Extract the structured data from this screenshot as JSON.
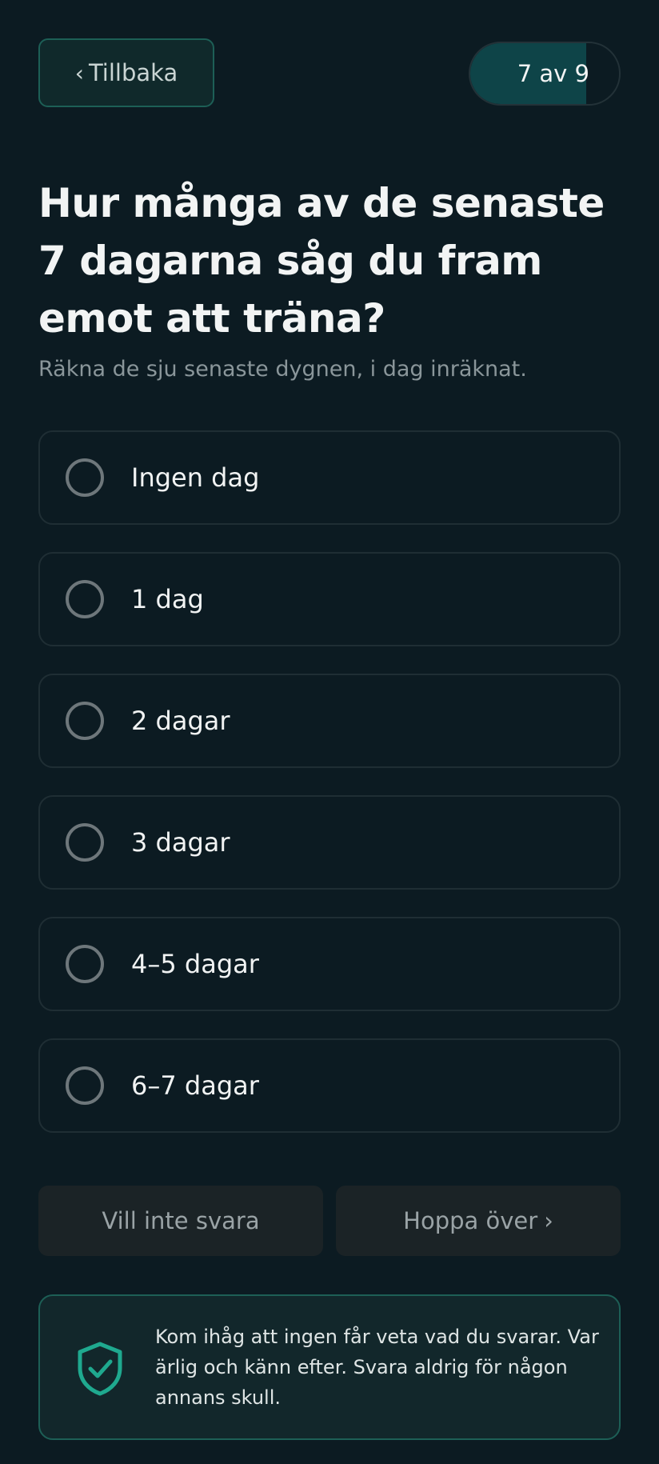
{
  "header": {
    "back_label": "Tillbaka",
    "back_chevron": "‹",
    "progress_label": "7 av 9",
    "progress_current": 7,
    "progress_total": 9
  },
  "question": {
    "title": "Hur många av de senaste 7 dagarna såg du fram emot att träna?",
    "hint": "Räkna de sju senaste dygnen, i dag inräknat."
  },
  "options": [
    {
      "label": "Ingen dag",
      "selected": false
    },
    {
      "label": "1 dag",
      "selected": false
    },
    {
      "label": "2 dagar",
      "selected": false
    },
    {
      "label": "3 dagar",
      "selected": false
    },
    {
      "label": "4–5 dagar",
      "selected": false
    },
    {
      "label": "6–7 dagar",
      "selected": false
    }
  ],
  "actions": {
    "decline_label": "Vill inte svara",
    "skip_label": "Hoppa över",
    "skip_chevron": "›"
  },
  "notice": {
    "icon": "shield-check-icon",
    "text": "Kom ihåg att ingen får veta vad du svarar. Var ärlig och känn efter. Svara aldrig för någon annans skull."
  },
  "colors": {
    "background": "#0c1b22",
    "accent": "#1fa98f",
    "border_accent": "#1d5f56",
    "progress_fill": "#0e4448"
  }
}
